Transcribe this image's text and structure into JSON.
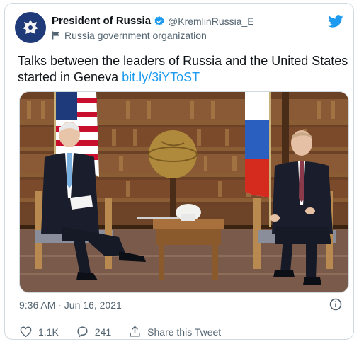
{
  "account": {
    "display_name": "President of Russia",
    "handle": "@KremlinRussia_E",
    "label": "Russia government organization"
  },
  "tweet": {
    "text": "Talks between the leaders of Russia and the United States started in Geneva ",
    "link": "bit.ly/3iYToST",
    "timestamp": "9:36 AM · Jun 16, 2021"
  },
  "actions": {
    "likes": "1.1K",
    "replies": "241",
    "share_label": "Share this Tweet"
  },
  "colors": {
    "link": "#1d9bf0",
    "verified": "#1d9bf0",
    "muted": "#536471"
  },
  "icons": [
    "russian-emblem-icon",
    "verified-badge-icon",
    "flag-icon",
    "twitter-bird-icon",
    "info-icon",
    "heart-icon",
    "reply-icon",
    "share-icon"
  ]
}
